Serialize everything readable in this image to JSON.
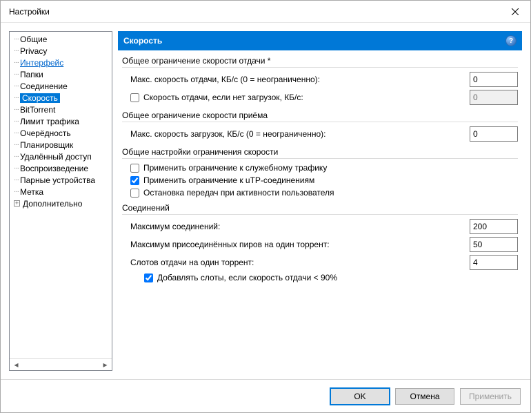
{
  "window": {
    "title": "Настройки"
  },
  "tree": {
    "items": [
      {
        "label": "Общие"
      },
      {
        "label": "Privacy"
      },
      {
        "label": "Интерфейс",
        "link": true
      },
      {
        "label": "Папки"
      },
      {
        "label": "Соединение"
      },
      {
        "label": "Скорость",
        "selected": true
      },
      {
        "label": "BitTorrent"
      },
      {
        "label": "Лимит трафика"
      },
      {
        "label": "Очерёдность"
      },
      {
        "label": "Планировщик"
      },
      {
        "label": "Удалённый доступ"
      },
      {
        "label": "Воспроизведение"
      },
      {
        "label": "Парные устройства"
      },
      {
        "label": "Метка"
      },
      {
        "label": "Дополнительно",
        "expandable": true
      }
    ]
  },
  "header": {
    "title": "Скорость"
  },
  "groups": {
    "upload": {
      "title": "Общее ограничение скорости отдачи *",
      "max_label": "Макс. скорость отдачи, КБ/с (0 = неограниченно):",
      "max_value": "0",
      "alt_label": "Скорость отдачи, если нет загрузок, КБ/с:",
      "alt_value": "0",
      "alt_checked": false
    },
    "download": {
      "title": "Общее ограничение скорости приёма",
      "max_label": "Макс. скорость загрузок, КБ/с (0 = неограниченно):",
      "max_value": "0"
    },
    "common": {
      "title": "Общие настройки ограничения скорости",
      "c1_label": "Применить ограничение к служебному трафику",
      "c1_checked": false,
      "c2_label": "Применить ограничение к uTP-соединениям",
      "c2_checked": true,
      "c3_label": "Остановка передач при активности пользователя",
      "c3_checked": false
    },
    "conn": {
      "title": "Соединений",
      "max_conn_label": "Максимум соединений:",
      "max_conn_value": "200",
      "max_peers_label": "Максимум присоединённых пиров на один торрент:",
      "max_peers_value": "50",
      "slots_label": "Слотов отдачи на один торрент:",
      "slots_value": "4",
      "add_slots_label": "Добавлять слоты, если скорость отдачи < 90%",
      "add_slots_checked": true
    }
  },
  "buttons": {
    "ok": "OK",
    "cancel": "Отмена",
    "apply": "Применить"
  }
}
